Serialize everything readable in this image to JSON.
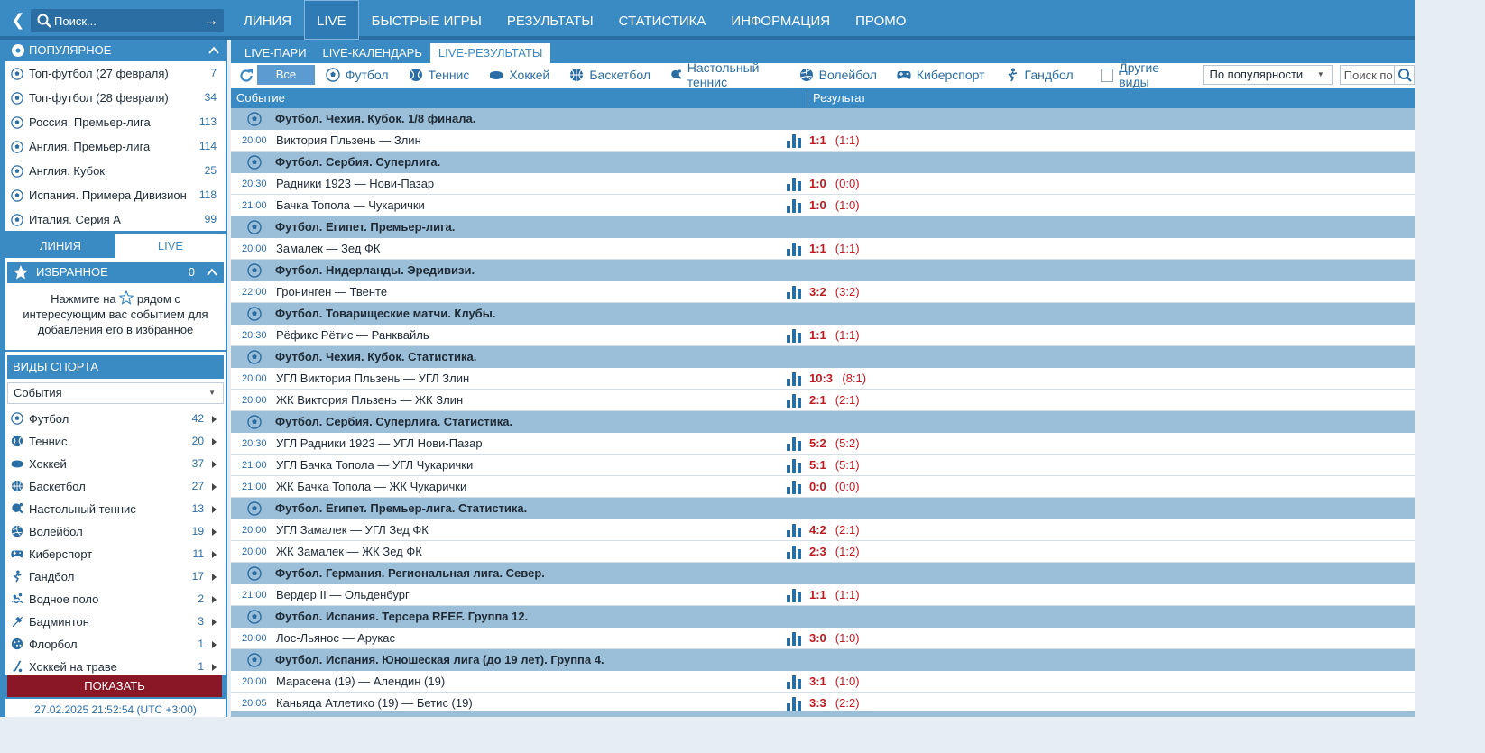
{
  "search": {
    "placeholder": "Поиск..."
  },
  "nav": [
    "ЛИНИЯ",
    "LIVE",
    "БЫСТРЫЕ ИГРЫ",
    "РЕЗУЛЬТАТЫ",
    "СТАТИСТИКА",
    "ИНФОРМАЦИЯ",
    "ПРОМО"
  ],
  "nav_active": "LIVE",
  "popular": {
    "title": "ПОПУЛЯРНОЕ",
    "items": [
      {
        "label": "Топ-футбол (27 февраля)",
        "count": "7"
      },
      {
        "label": "Топ-футбол (28 февраля)",
        "count": "34"
      },
      {
        "label": "Россия. Премьер-лига",
        "count": "113"
      },
      {
        "label": "Англия. Премьер-лига",
        "count": "114"
      },
      {
        "label": "Англия. Кубок",
        "count": "25"
      },
      {
        "label": "Испания. Примера Дивизион",
        "count": "118"
      },
      {
        "label": "Италия. Серия А",
        "count": "99"
      }
    ]
  },
  "side_tabs": {
    "line": "ЛИНИЯ",
    "live": "LIVE"
  },
  "favorites": {
    "title": "ИЗБРАННОЕ",
    "count": "0",
    "hint_before": "Нажмите на",
    "hint_after": "рядом с интересующим вас событием для добавления его в избранное"
  },
  "sports_panel": {
    "title": "ВИДЫ СПОРТА",
    "select_value": "События",
    "items": [
      {
        "label": "Футбол",
        "count": "42",
        "icon": "football-icon"
      },
      {
        "label": "Теннис",
        "count": "20",
        "icon": "tennis-icon"
      },
      {
        "label": "Хоккей",
        "count": "37",
        "icon": "hockey-icon"
      },
      {
        "label": "Баскетбол",
        "count": "27",
        "icon": "basketball-icon"
      },
      {
        "label": "Настольный теннис",
        "count": "13",
        "icon": "table-tennis-icon"
      },
      {
        "label": "Волейбол",
        "count": "19",
        "icon": "volleyball-icon"
      },
      {
        "label": "Киберспорт",
        "count": "11",
        "icon": "gamepad-icon"
      },
      {
        "label": "Гандбол",
        "count": "17",
        "icon": "handball-icon"
      },
      {
        "label": "Водное поло",
        "count": "2",
        "icon": "water-polo-icon"
      },
      {
        "label": "Бадминтон",
        "count": "3",
        "icon": "badminton-icon"
      },
      {
        "label": "Флорбол",
        "count": "1",
        "icon": "floorball-icon"
      },
      {
        "label": "Хоккей на траве",
        "count": "1",
        "icon": "field-hockey-icon"
      }
    ]
  },
  "show_button": "ПОКАЗАТЬ",
  "clock": "27.02.2025 21:52:54 (UTC +3:00)",
  "subtabs": [
    "LIVE-ПАРИ",
    "LIVE-КАЛЕНДАРЬ",
    "LIVE-РЕЗУЛЬТАТЫ"
  ],
  "subtab_active": "LIVE-РЕЗУЛЬТАТЫ",
  "filters": {
    "all": "Все",
    "sports": [
      {
        "label": "Футбол",
        "icon": "football-icon"
      },
      {
        "label": "Теннис",
        "icon": "tennis-icon"
      },
      {
        "label": "Хоккей",
        "icon": "hockey-icon"
      },
      {
        "label": "Баскетбол",
        "icon": "basketball-icon"
      },
      {
        "label": "Настольный теннис",
        "icon": "table-tennis-icon"
      },
      {
        "label": "Волейбол",
        "icon": "volleyball-icon"
      },
      {
        "label": "Киберспорт",
        "icon": "gamepad-icon"
      },
      {
        "label": "Гандбол",
        "icon": "handball-icon"
      }
    ],
    "other": "Другие виды",
    "sort": "По популярности",
    "search_placeholder": "Поиск по"
  },
  "columns": {
    "event": "Событие",
    "result": "Результат"
  },
  "groups": [
    {
      "title": "Футбол. Чехия. Кубок. 1/8 финала.",
      "events": [
        {
          "time": "20:00",
          "name": "Виктория Пльзень — Злин",
          "score": "1:1",
          "half": "(1:1)"
        }
      ]
    },
    {
      "title": "Футбол. Сербия. Суперлига.",
      "events": [
        {
          "time": "20:30",
          "name": "Радники 1923 — Нови-Пазар",
          "score": "1:0",
          "half": "(0:0)"
        },
        {
          "time": "21:00",
          "name": "Бачка Топола — Чукарички",
          "score": "1:0",
          "half": "(1:0)"
        }
      ]
    },
    {
      "title": "Футбол. Египет. Премьер-лига.",
      "events": [
        {
          "time": "20:00",
          "name": "Замалек — Зед ФК",
          "score": "1:1",
          "half": "(1:1)"
        }
      ]
    },
    {
      "title": "Футбол. Нидерланды. Эредивизи.",
      "events": [
        {
          "time": "22:00",
          "name": "Гронинген — Твенте",
          "score": "3:2",
          "half": "(3:2)"
        }
      ]
    },
    {
      "title": "Футбол. Товарищеские матчи. Клубы.",
      "events": [
        {
          "time": "20:30",
          "name": "Рёфикс Рётис — Ранквайль",
          "score": "1:1",
          "half": "(1:1)"
        }
      ]
    },
    {
      "title": "Футбол. Чехия. Кубок. Статистика.",
      "events": [
        {
          "time": "20:00",
          "name": "УГЛ Виктория Пльзень — УГЛ Злин",
          "score": "10:3",
          "half": "(8:1)"
        },
        {
          "time": "20:00",
          "name": "ЖК Виктория Пльзень — ЖК Злин",
          "score": "2:1",
          "half": "(2:1)"
        }
      ]
    },
    {
      "title": "Футбол. Сербия. Суперлига. Статистика.",
      "events": [
        {
          "time": "20:30",
          "name": "УГЛ Радники 1923 — УГЛ Нови-Пазар",
          "score": "5:2",
          "half": "(5:2)"
        },
        {
          "time": "21:00",
          "name": "УГЛ Бачка Топола — УГЛ Чукарички",
          "score": "5:1",
          "half": "(5:1)"
        },
        {
          "time": "21:00",
          "name": "ЖК Бачка Топола — ЖК Чукарички",
          "score": "0:0",
          "half": "(0:0)"
        }
      ]
    },
    {
      "title": "Футбол. Египет. Премьер-лига. Статистика.",
      "events": [
        {
          "time": "20:00",
          "name": "УГЛ Замалек — УГЛ Зед ФК",
          "score": "4:2",
          "half": "(2:1)"
        },
        {
          "time": "20:00",
          "name": "ЖК Замалек — ЖК Зед ФК",
          "score": "2:3",
          "half": "(1:2)"
        }
      ]
    },
    {
      "title": "Футбол. Германия. Региональная лига. Север.",
      "events": [
        {
          "time": "21:00",
          "name": "Вердер II — Ольденбург",
          "score": "1:1",
          "half": "(1:1)"
        }
      ]
    },
    {
      "title": "Футбол. Испания. Терсера RFEF. Группа 12.",
      "events": [
        {
          "time": "20:00",
          "name": "Лос-Льянос — Арукас",
          "score": "3:0",
          "half": "(1:0)"
        }
      ]
    },
    {
      "title": "Футбол. Испания. Юношеская лига (до 19 лет). Группа 4.",
      "events": [
        {
          "time": "20:00",
          "name": "Марасена (19) — Алендин (19)",
          "score": "3:1",
          "half": "(1:0)"
        },
        {
          "time": "20:05",
          "name": "Каньяда Атлетико (19) — Бетис (19)",
          "score": "3:3",
          "half": "(2:2)"
        }
      ]
    }
  ],
  "colors": {
    "brand": "#3a8ac4",
    "group_bg": "#9bbfd8",
    "score": "#c2191f",
    "show_button": "#8a1726"
  }
}
